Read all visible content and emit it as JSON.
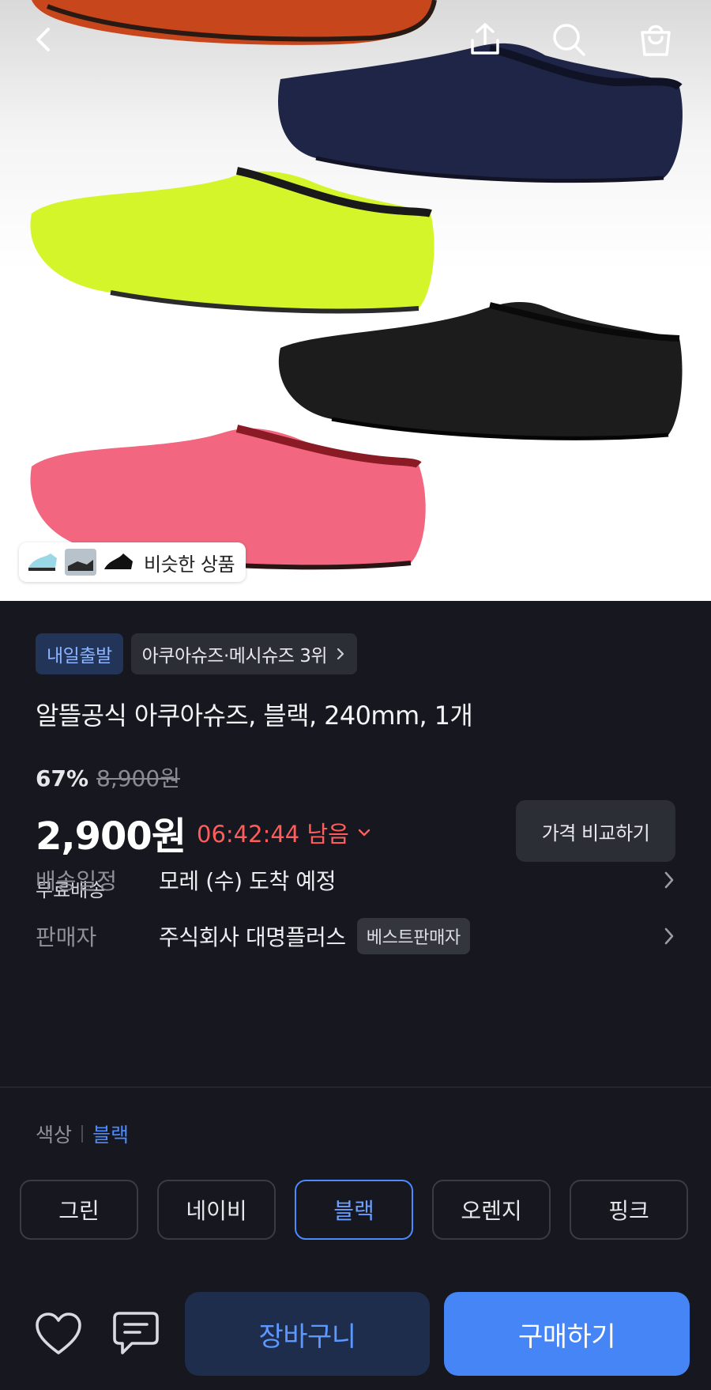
{
  "header": {
    "back_icon": "chevron-left-icon",
    "share_icon": "share-icon",
    "search_icon": "search-icon",
    "cart_icon": "shopping-bag-icon"
  },
  "hero": {
    "similar_label": "비슷한 상품"
  },
  "product": {
    "delivery_badge": "내일출발",
    "rank_badge": "아쿠아슈즈·메시슈즈 3위",
    "title": "알뜰공식 아쿠아슈즈, 블랙, 240mm, 1개",
    "discount_percent": "67%",
    "original_price": "8,900원",
    "price": "2,900원",
    "countdown": "06:42:44 남음",
    "compare_label": "가격 비교하기",
    "shipping_fee": "무료배송"
  },
  "delivery": {
    "label": "배송일정",
    "value": "모레 (수) 도착 예정"
  },
  "seller": {
    "label": "판매자",
    "value": "주식회사 대명플러스",
    "badge": "베스트판매자"
  },
  "color": {
    "label": "색상",
    "selected": "블랙",
    "options": [
      "그린",
      "네이비",
      "블랙",
      "오렌지",
      "핑크"
    ]
  },
  "actions": {
    "wishlist_icon": "heart-icon",
    "inquiry_icon": "chat-icon",
    "cart_label": "장바구니",
    "buy_label": "구매하기"
  },
  "colors": {
    "background": "#17181f",
    "accent": "#4585f5",
    "countdown": "#ff5c5c"
  }
}
